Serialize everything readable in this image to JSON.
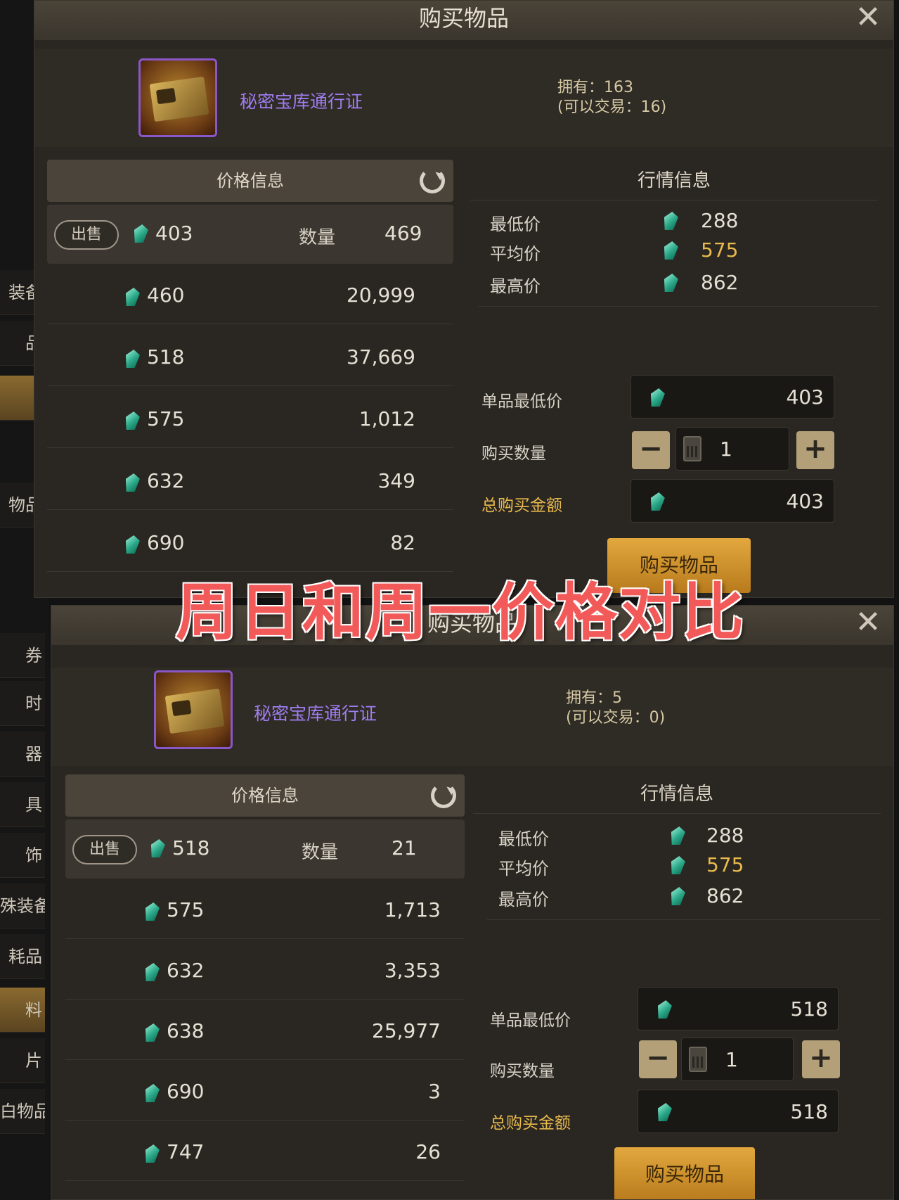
{
  "overlay": {
    "title": "周日和周一价格对比"
  },
  "sidebar_fragments": [
    "装备",
    "品",
    "",
    "物品",
    "券",
    "时",
    "器",
    "具",
    "饰",
    "殊装备",
    "耗品",
    "料",
    "片",
    "白物品"
  ],
  "panels": [
    {
      "title": "购买物品",
      "item_name": "秘密宝库通行证",
      "owned": "拥有：163",
      "tradable": "(可以交易：16)",
      "price_header": "价格信息",
      "sell_label": "出售",
      "quantity_label": "数量",
      "current": {
        "price": "403",
        "qty": "469"
      },
      "listings": [
        {
          "price": "460",
          "qty": "20,999"
        },
        {
          "price": "518",
          "qty": "37,669"
        },
        {
          "price": "575",
          "qty": "1,012"
        },
        {
          "price": "632",
          "qty": "349"
        },
        {
          "price": "690",
          "qty": "82"
        }
      ],
      "market_header": "行情信息",
      "min_label": "最低价",
      "min_val": "288",
      "avg_label": "平均价",
      "avg_val": "575",
      "max_label": "最高价",
      "max_val": "862",
      "unit_min_label": "单品最低价",
      "unit_min_val": "403",
      "buy_qty_label": "购买数量",
      "buy_qty_val": "1",
      "total_label": "总购买金额",
      "total_val": "403",
      "buy_button": "购买物品"
    },
    {
      "title": "购买物品",
      "item_name": "秘密宝库通行证",
      "owned": "拥有：5",
      "tradable": "(可以交易：0)",
      "price_header": "价格信息",
      "sell_label": "出售",
      "quantity_label": "数量",
      "current": {
        "price": "518",
        "qty": "21"
      },
      "listings": [
        {
          "price": "575",
          "qty": "1,713"
        },
        {
          "price": "632",
          "qty": "3,353"
        },
        {
          "price": "638",
          "qty": "25,977"
        },
        {
          "price": "690",
          "qty": "3"
        },
        {
          "price": "747",
          "qty": "26"
        }
      ],
      "market_header": "行情信息",
      "min_label": "最低价",
      "min_val": "288",
      "avg_label": "平均价",
      "avg_val": "575",
      "max_label": "最高价",
      "max_val": "862",
      "unit_min_label": "单品最低价",
      "unit_min_val": "518",
      "buy_qty_label": "购买数量",
      "buy_qty_val": "1",
      "total_label": "总购买金额",
      "total_val": "518",
      "buy_button": "购买物品"
    }
  ]
}
